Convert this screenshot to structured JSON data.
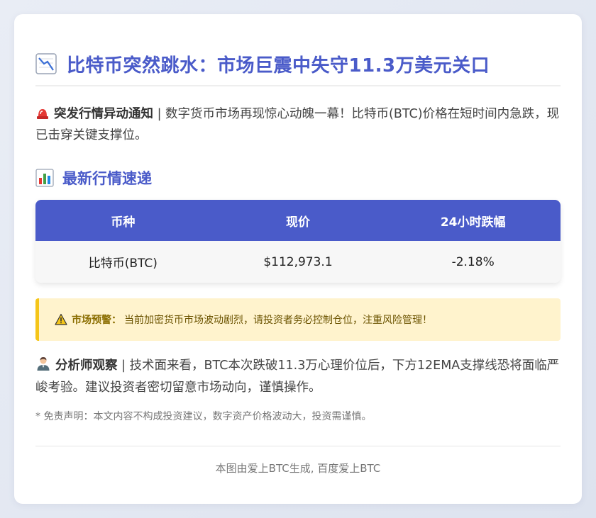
{
  "title": {
    "icon": "chart-decreasing-icon",
    "text": "比特币突然跳水：市场巨震中失守11.3万美元关口"
  },
  "alert": {
    "icon": "police-light-icon",
    "label": "突发行情异动通知",
    "text": " | 数字货币市场再现惊心动魄一幕！比特币(BTC)价格在短时间内急跌，现已击穿关键支撑位。"
  },
  "section": {
    "icon": "bar-chart-icon",
    "title": "最新行情速递"
  },
  "table": {
    "headers": [
      "币种",
      "现价",
      "24小时跌幅"
    ],
    "rows": [
      [
        "比特币(BTC)",
        "$112,973.1",
        "-2.18%"
      ]
    ]
  },
  "warning": {
    "icon": "warning-icon",
    "label": "市场预警：",
    "text": "当前加密货币市场波动剧烈，请投资者务必控制仓位，注重风险管理！"
  },
  "analyst": {
    "icon": "analyst-person-icon",
    "label": "分析师观察",
    "text": " | 技术面来看，BTC本次跌破11.3万心理价位后，下方12EMA支撑线恐将面临严峻考验。建议投资者密切留意市场动向，谨慎操作。"
  },
  "disclaimer": "* 免责声明：本文内容不构成投资建议，数字资产价格波动大，投资需谨慎。",
  "footer": "本图由爱上BTC生成, 百度爱上BTC",
  "colors": {
    "accent": "#4a5bc9",
    "warning_bg": "#fff3cd",
    "warning_border": "#f5c518"
  }
}
